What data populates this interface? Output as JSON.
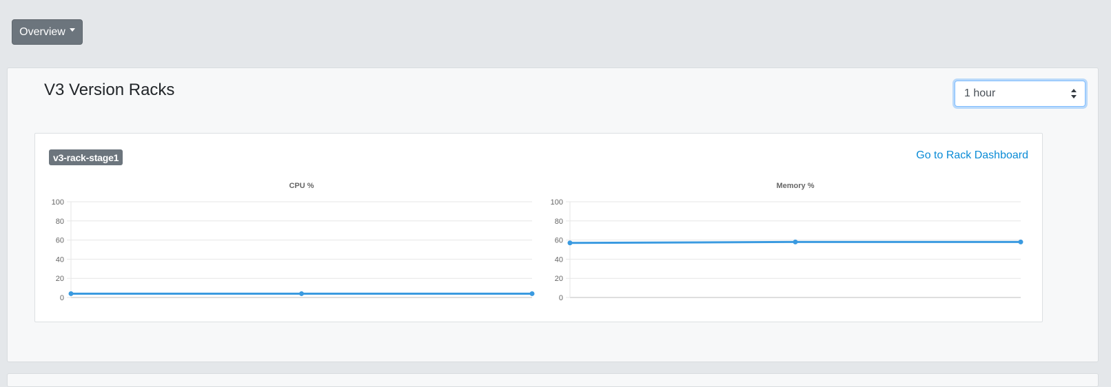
{
  "header": {
    "overview_label": "Overview"
  },
  "section": {
    "title": "V3 Version Racks",
    "range_select": {
      "selected": "1 hour"
    }
  },
  "rack": {
    "name": "v3-rack-stage1",
    "dashboard_link": "Go to Rack Dashboard"
  },
  "colors": {
    "line": "#3a9ae0",
    "badge": "#6c757d",
    "link": "#0a8bd6"
  },
  "chart_data": [
    {
      "type": "line",
      "title": "CPU %",
      "x": [
        1,
        2,
        3
      ],
      "series": [
        {
          "values": [
            4,
            4,
            4
          ]
        }
      ],
      "ylim": [
        0,
        100
      ],
      "yticks": [
        0,
        20,
        40,
        60,
        80,
        100
      ],
      "grid": true,
      "legend": "none"
    },
    {
      "type": "line",
      "title": "Memory %",
      "x": [
        1,
        2,
        3
      ],
      "series": [
        {
          "values": [
            57,
            58,
            58
          ]
        }
      ],
      "ylim": [
        0,
        100
      ],
      "yticks": [
        0,
        20,
        40,
        60,
        80,
        100
      ],
      "grid": true,
      "legend": "none"
    }
  ]
}
